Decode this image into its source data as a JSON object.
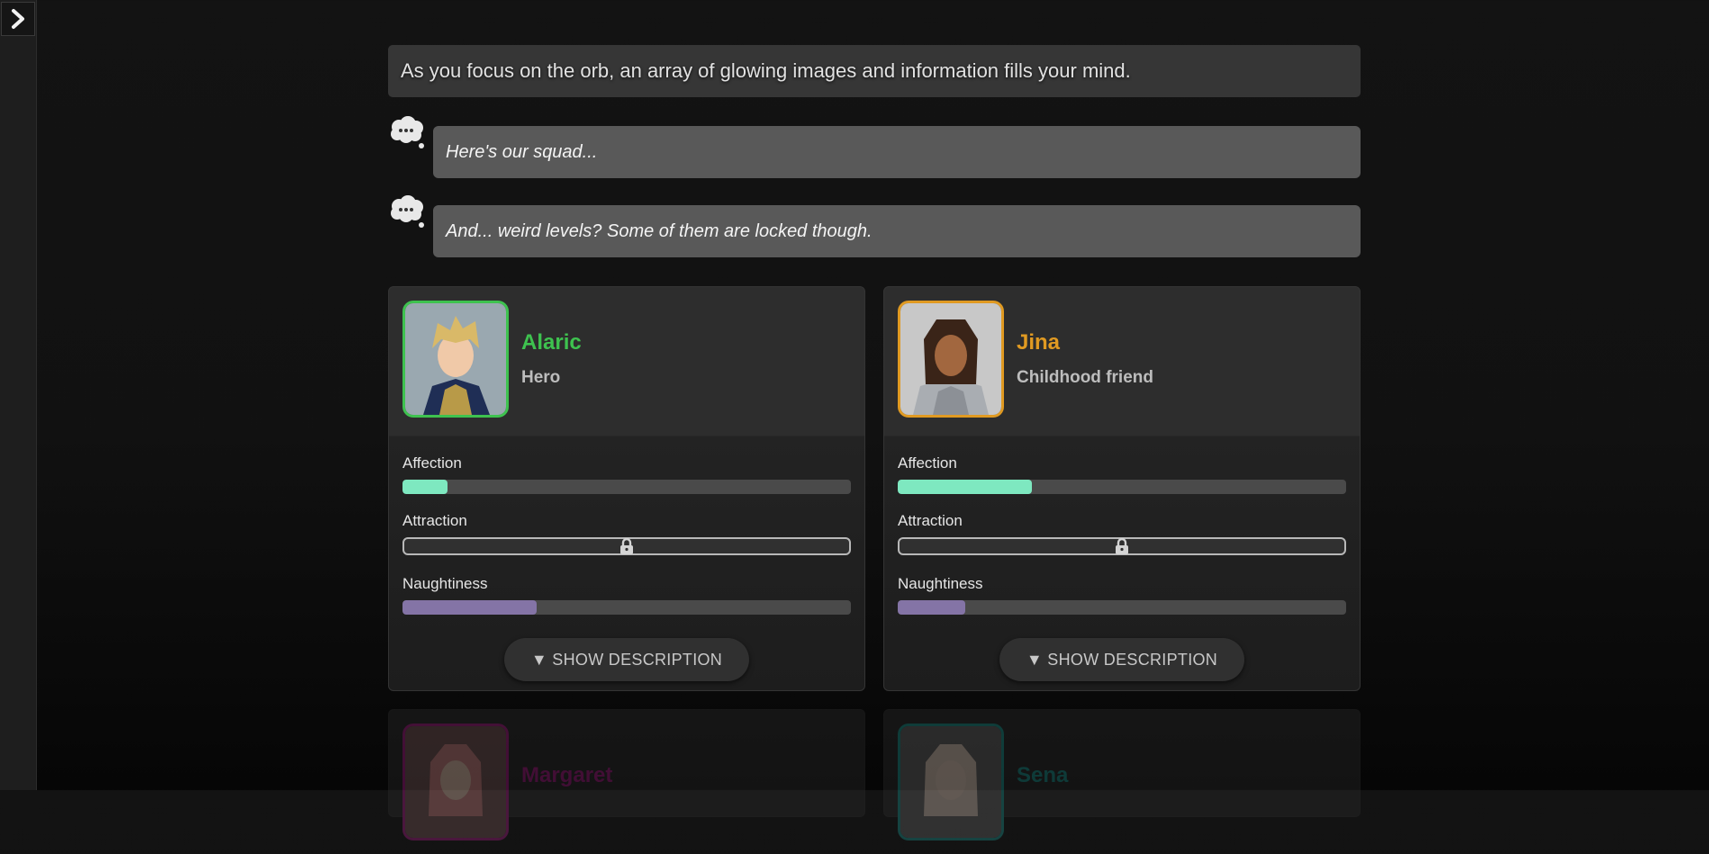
{
  "sidebar": {
    "toggle_icon": "chevron-right-icon"
  },
  "narration": "As you focus on the orb, an array of glowing images and information fills your mind.",
  "thoughts": [
    {
      "text": "Here's our squad...",
      "icon": "thought-bubble-icon"
    },
    {
      "text": "And... weird levels? Some of them are locked though.",
      "icon": "thought-bubble-icon"
    }
  ],
  "characters": [
    {
      "name": "Alaric",
      "role": "Hero",
      "accent": "#3ec24f",
      "stats": [
        {
          "label": "Affection",
          "value": 0.1,
          "locked": false,
          "color": "#7ee8c0"
        },
        {
          "label": "Attraction",
          "value": null,
          "locked": true
        },
        {
          "label": "Naughtiness",
          "value": 0.3,
          "locked": false,
          "color": "#8474a6"
        }
      ],
      "button": "▼ SHOW DESCRIPTION"
    },
    {
      "name": "Jina",
      "role": "Childhood friend",
      "accent": "#e09a22",
      "stats": [
        {
          "label": "Affection",
          "value": 0.3,
          "locked": false,
          "color": "#7ee8c0"
        },
        {
          "label": "Attraction",
          "value": null,
          "locked": true
        },
        {
          "label": "Naughtiness",
          "value": 0.15,
          "locked": false,
          "color": "#8474a6"
        }
      ],
      "button": "▼ SHOW DESCRIPTION"
    },
    {
      "name": "Margaret",
      "accent": "#b01f8c"
    },
    {
      "name": "Sena",
      "accent": "#1e9c96"
    }
  ]
}
